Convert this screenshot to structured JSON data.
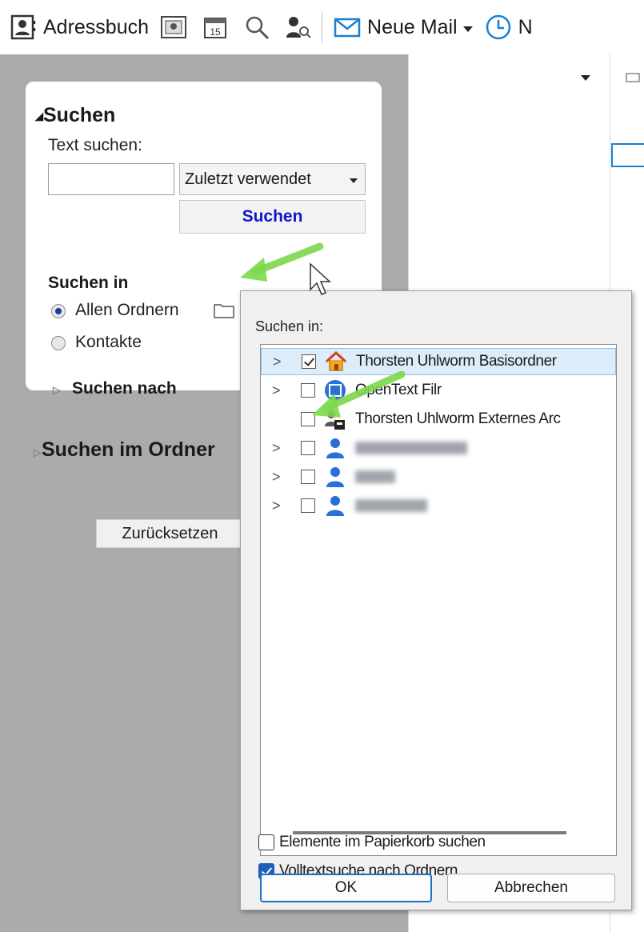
{
  "toolbar": {
    "address_book": "Adressbuch",
    "new_mail": "Neue Mail",
    "cut_label": "N",
    "accent": "#1a7fd4"
  },
  "search_panel": {
    "section_search": "Suchen",
    "text_search_label": "Text suchen:",
    "text_value": "",
    "combo_value": "Zuletzt verwendet",
    "search_button": "Suchen",
    "search_in_label": "Suchen in",
    "radio_all_folders": "Allen Ordnern",
    "radio_contacts": "Kontakte",
    "search_by": "Suchen nach",
    "search_in_folder": "Suchen im Ordner",
    "reset_button": "Zurücksetzen"
  },
  "popup": {
    "label": "Suchen in:",
    "tree": [
      {
        "label": "Thorsten Uhlworm Basisordner",
        "checked": true,
        "icon": "home-icon",
        "expandable": true
      },
      {
        "label": "OpenText Filr",
        "checked": false,
        "icon": "filr-icon",
        "expandable": true
      },
      {
        "label": "Thorsten Uhlworm Externes Arc",
        "checked": false,
        "icon": "archive-icon",
        "expandable": false
      },
      {
        "label": "",
        "checked": false,
        "icon": "contact-icon",
        "expandable": true
      },
      {
        "label": "",
        "checked": false,
        "icon": "contact-icon",
        "expandable": true
      },
      {
        "label": "",
        "checked": false,
        "icon": "contact-icon",
        "expandable": true
      }
    ],
    "option_trash": "Elemente im Papierkorb suchen",
    "option_trash_checked": false,
    "option_fulltext": "Volltextsuche nach Ordnern",
    "option_fulltext_checked": true,
    "ok": "OK",
    "cancel": "Abbrechen"
  }
}
